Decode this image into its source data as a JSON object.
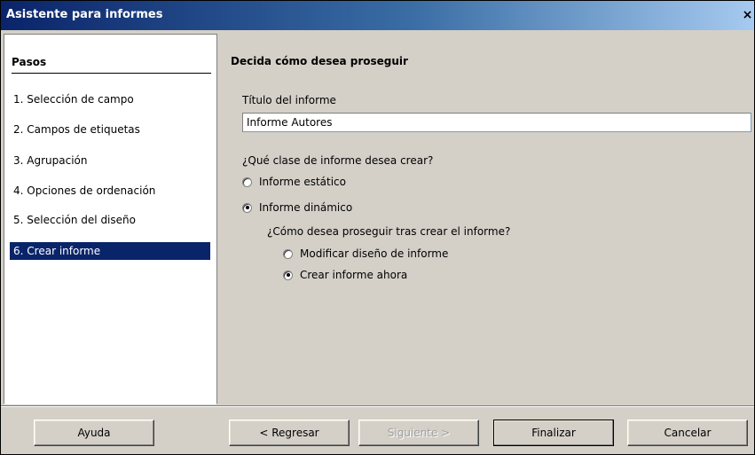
{
  "window": {
    "title": "Asistente para informes",
    "close_glyph": "×"
  },
  "sidebar": {
    "title": "Pasos",
    "steps": [
      {
        "num": "1.",
        "label": "Selección de campo",
        "selected": false
      },
      {
        "num": "2.",
        "label": "Campos de etiquetas",
        "selected": false
      },
      {
        "num": "3.",
        "label": "Agrupación",
        "selected": false
      },
      {
        "num": "4.",
        "label": "Opciones de ordenación",
        "selected": false
      },
      {
        "num": "5.",
        "label": "Selección del diseño",
        "selected": false
      },
      {
        "num": "6.",
        "label": "Crear informe",
        "selected": true
      }
    ]
  },
  "main": {
    "heading": "Decida cómo desea proseguir",
    "title_label": "Título del informe",
    "title_value": "Informe Autores",
    "type_question": "¿Qué clase de informe desea crear?",
    "static_option": "Informe estático",
    "dynamic_option": "Informe dinámico",
    "static_selected": false,
    "dynamic_selected": true,
    "after_question": "¿Cómo desea proseguir tras crear el informe?",
    "modify_option": "Modificar diseño de informe",
    "create_option": "Crear informe ahora",
    "modify_selected": false,
    "create_selected": true
  },
  "buttons": {
    "help": "Ayuda",
    "back": "< Regresar",
    "next": "Siguiente >",
    "finish": "Finalizar",
    "cancel": "Cancelar"
  }
}
